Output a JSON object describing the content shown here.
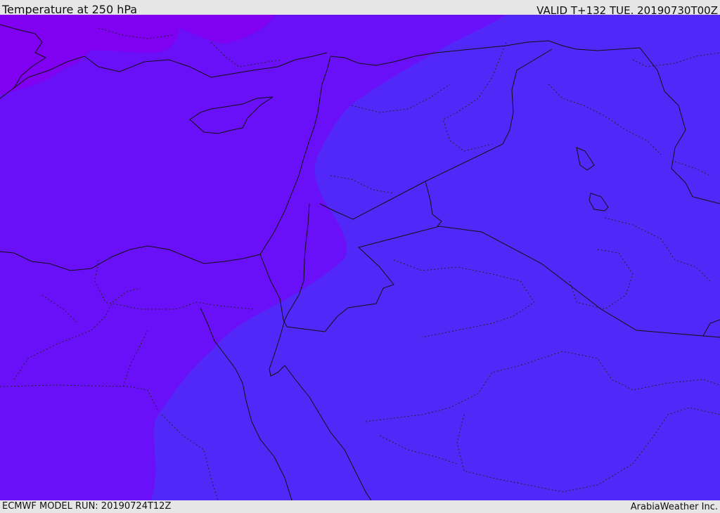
{
  "header": {
    "title": "Temperature at 250 hPa",
    "valid_time": "VALID T+132 TUE. 20190730T00Z"
  },
  "footer": {
    "model_run": "ECMWF MODEL RUN: 20190724T12Z",
    "credit": "ArabiaWeather Inc."
  },
  "map": {
    "field": "temperature",
    "pressure_level_hpa": 250,
    "colors": {
      "coldest_band": "#8000f2",
      "cold_band": "#6a10f8",
      "cool_band": "#5228f8"
    }
  }
}
